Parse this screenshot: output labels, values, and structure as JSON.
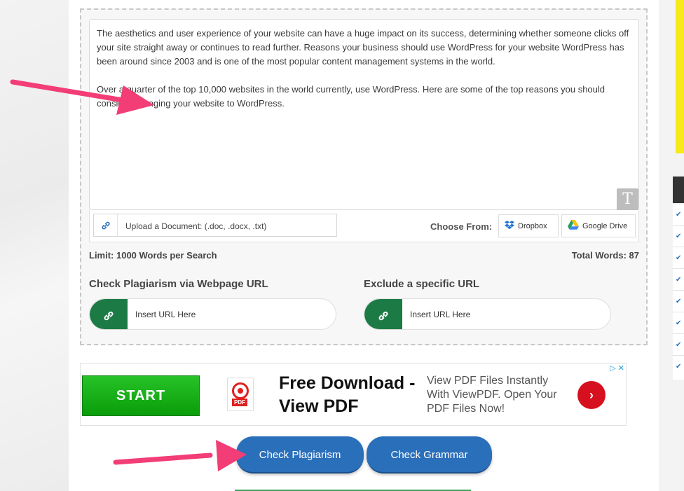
{
  "editor": {
    "paragraphs": [
      "The aesthetics and user experience of your website can have a huge impact on its success, determining whether someone clicks off your site straight away or continues to read further. Reasons your business should use WordPress for your website WordPress has been around since 2003 and is one of the most popular content management systems in the world.",
      "Over a quarter of the top 10,000 websites in the world currently, use WordPress. Here are some of the top reasons you should consider changing your website to WordPress."
    ],
    "format_icon": "T"
  },
  "upload": {
    "label": "Upload a Document: (.doc, .docx, .txt)",
    "choose_from": "Choose From:",
    "dropbox": "Dropbox",
    "google_drive": "Google Drive"
  },
  "limits": {
    "limit_text": "Limit: 1000 Words per Search",
    "total_words_text": "Total Words: 87"
  },
  "url_check": {
    "heading": "Check Plagiarism via Webpage URL",
    "placeholder": "Insert URL Here"
  },
  "url_exclude": {
    "heading": "Exclude a specific URL",
    "placeholder": "Insert URL Here"
  },
  "ad": {
    "start_label": "START",
    "pdf_tag": "PDF",
    "headline": "Free Download - View PDF",
    "description": "View PDF Files Instantly With ViewPDF. Open Your PDF Files Now!",
    "arrow": "›",
    "adchoices": "▷ ✕"
  },
  "actions": {
    "check_plagiarism": "Check Plagiarism",
    "check_grammar": "Check Grammar"
  },
  "colors": {
    "button_blue": "#2a6fba",
    "url_icon_green": "#1c7a45",
    "annotation_pink": "#f23d76",
    "ad_start_green": "#14ad14"
  }
}
